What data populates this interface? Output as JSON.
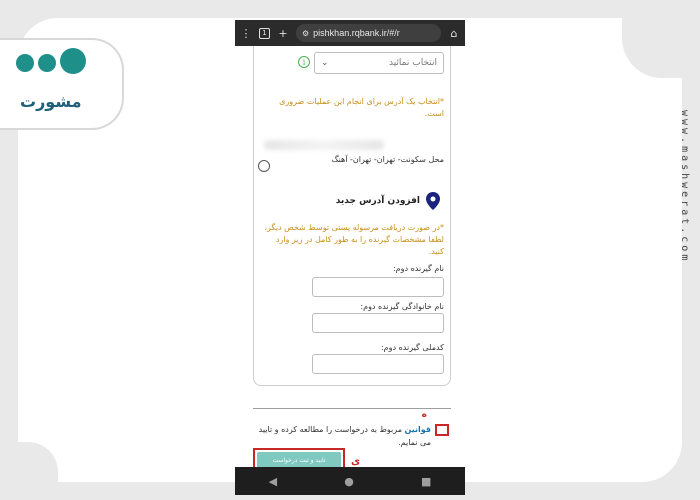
{
  "watermark": "www.mashwerat.com",
  "logo": {
    "text": "مشورت"
  },
  "browser": {
    "menu_icon": "⋮",
    "tab_count": "1",
    "new_tab_icon": "+",
    "site_settings_icon": "⚙",
    "url": "pishkhan.rqbank.ir/#/r",
    "home_icon": "⌂"
  },
  "form": {
    "select_placeholder": "انتخاب نمائید",
    "info_icon": "i",
    "address_required_note": "*انتخاب یک آدرس برای انجام این عملیات ضروری است.",
    "saved_address": "محل سکونت- تهران- تهران- آهنگ",
    "add_address_label": "افزودن آدرس جدید",
    "second_receiver_note": "*در صورت دریافت مرسوله پستی توسط شخص دیگر، لطفا مشخصات گیرنده را به طور کامل در زیر وارد کنید.",
    "fields": [
      {
        "label": "نام گیرنده دوم:",
        "value": ""
      },
      {
        "label": "نام خانوادگی گیرنده دوم:",
        "value": ""
      },
      {
        "label": "کدملی گیرنده دوم:",
        "value": ""
      }
    ]
  },
  "terms": {
    "link": "قوانین",
    "text": "مربوط به درخواست را مطالعه کرده و تایید می نمایم."
  },
  "submit_label": "تایید و ثبت درخواست",
  "annotations": {
    "marker_h": "ه",
    "marker_y": "ی"
  },
  "colors": {
    "accent": "#7fc9c1",
    "highlight": "#c62828",
    "warning_text": "#c89018",
    "brand": "#1f8f8a"
  }
}
